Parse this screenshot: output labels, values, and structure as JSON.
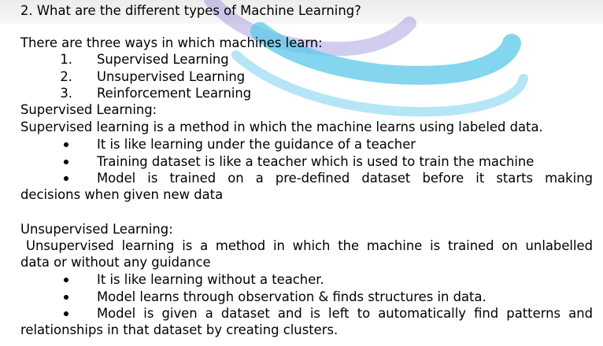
{
  "question": "2. What are the different types of Machine Learning?",
  "intro": "There are three ways in which machines learn:",
  "types": [
    {
      "num": "1.",
      "label": "Supervised Learning"
    },
    {
      "num": "2.",
      "label": "Unsupervised Learning"
    },
    {
      "num": "3.",
      "label": "Reinforcement Learning"
    }
  ],
  "supervised": {
    "heading": "Supervised Learning:",
    "definition": "Supervised learning is a method in which the machine learns using labeled data.",
    "bullets": [
      "It is like learning under the guidance of a teacher",
      "Training dataset is like a teacher which is used to train the machine",
      "Model is trained on a pre-defined dataset before it starts making"
    ],
    "continuation": "decisions when given new data"
  },
  "unsupervised": {
    "heading": "Unsupervised Learning:",
    "definition_line1": "Unsupervised learning is a method in which the machine is trained on unlabelled",
    "definition_line2": "data or without any guidance",
    "bullets": [
      "It is like learning without a teacher.",
      "Model learns through observation & finds structures in data.",
      "Model is given a dataset and is left to automatically find patterns and"
    ],
    "continuation": "relationships in that dataset by creating clusters."
  },
  "colors": {
    "watermark_blue": "#5bc8ea",
    "watermark_purple": "#7a6fd0"
  }
}
